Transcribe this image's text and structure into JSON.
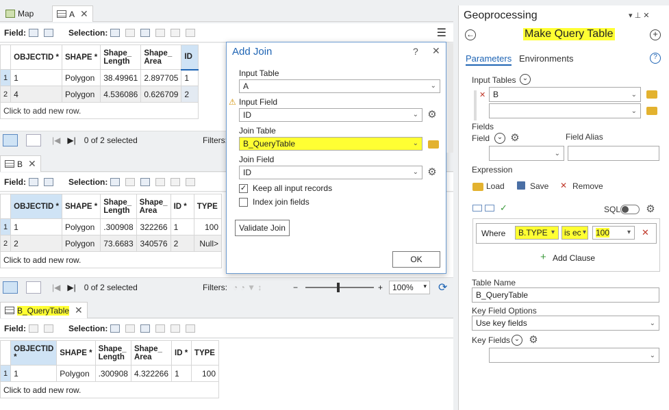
{
  "tabs_top": [
    {
      "label": "Map"
    },
    {
      "label": "A"
    }
  ],
  "tab_b": {
    "label": "B"
  },
  "tab_q": {
    "label": "B_QueryTable"
  },
  "toolbar": {
    "field_label": "Field:",
    "selection_label": "Selection:"
  },
  "table_a": {
    "headers": [
      "OBJECTID *",
      "SHAPE *",
      "Shape_ Length",
      "Shape_ Area",
      "ID"
    ],
    "rows": [
      [
        "1",
        "1",
        "Polygon",
        "38.49961",
        "2.897705",
        "1"
      ],
      [
        "2",
        "4",
        "Polygon",
        "4.536086",
        "0.626709",
        "2"
      ]
    ],
    "add_row": "Click to add new row.",
    "selected": "0 of 2 selected",
    "filters": "Filters:"
  },
  "table_b": {
    "headers": [
      "OBJECTID *",
      "SHAPE *",
      "Shape_ Length",
      "Shape_ Area",
      "ID *",
      "TYPE"
    ],
    "rows": [
      [
        "1",
        "1",
        "Polygon",
        ".300908",
        "322266",
        "1",
        "100"
      ],
      [
        "2",
        "2",
        "Polygon",
        "73.6683",
        "340576",
        "2",
        "Null>"
      ]
    ],
    "add_row": "Click to add new row.",
    "selected": "0 of 2 selected",
    "filters": "Filters:",
    "zoom": "100%"
  },
  "table_q": {
    "headers": [
      "OBJECTID *",
      "SHAPE *",
      "Shape_ Length",
      "Shape_ Area",
      "ID *",
      "TYPE"
    ],
    "rows": [
      [
        "1",
        "1",
        "Polygon",
        ".300908",
        "4.322266",
        "1",
        "100"
      ]
    ],
    "add_row": "Click to add new row."
  },
  "dialog": {
    "title": "Add Join",
    "help": "?",
    "input_table_label": "Input Table",
    "input_table": "A",
    "input_field_label": "Input Field",
    "input_field": "ID",
    "join_table_label": "Join Table",
    "join_table": "B_QueryTable",
    "join_field_label": "Join Field",
    "join_field": "ID",
    "keep_all": "Keep all input records",
    "index_join": "Index join fields",
    "validate": "Validate Join",
    "ok": "OK"
  },
  "gp": {
    "title": "Geoprocessing",
    "tool": "Make Query Table",
    "tab_params": "Parameters",
    "tab_env": "Environments",
    "input_tables_label": "Input Tables",
    "input_table_1": "B",
    "fields_label": "Fields",
    "field_label": "Field",
    "field_alias_label": "Field Alias",
    "expression_label": "Expression",
    "load": "Load",
    "save": "Save",
    "remove": "Remove",
    "sql": "SQL",
    "where": "Where",
    "clause_field": "B.TYPE",
    "clause_op": "is ec",
    "clause_val": "100",
    "add_clause": "Add Clause",
    "table_name_label": "Table Name",
    "table_name": "B_QueryTable",
    "key_field_options_label": "Key Field Options",
    "key_field_options": "Use key fields",
    "key_fields_label": "Key Fields"
  },
  "colors": {
    "highlight": "#ffff33",
    "selection": "#cfe3f5",
    "accent": "#1e64b4"
  }
}
